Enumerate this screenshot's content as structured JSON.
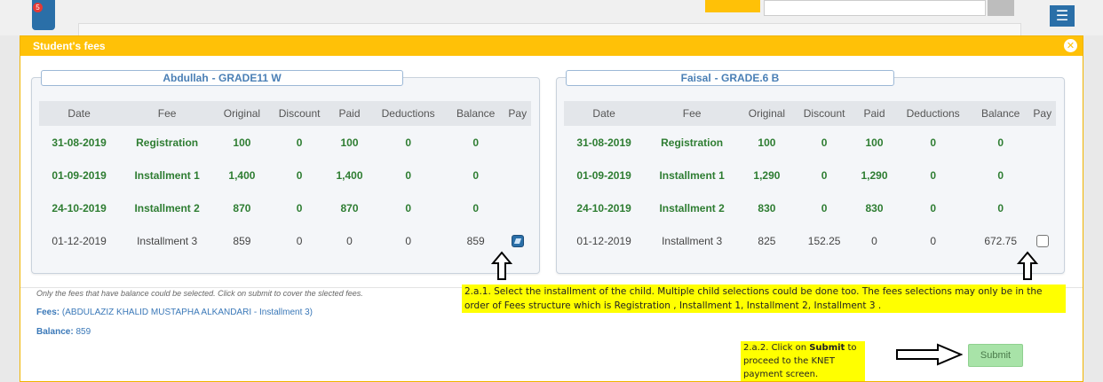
{
  "background": {
    "badge": "5",
    "menu_icon": "menu-icon"
  },
  "modal": {
    "title": "Student's fees",
    "close_icon": "close-icon"
  },
  "columns": [
    "Date",
    "Fee",
    "Original",
    "Discount",
    "Paid",
    "Deductions",
    "Balance",
    "Pay"
  ],
  "children": [
    {
      "name": "Abdullah",
      "grade": "- GRADE11 W",
      "rows": [
        {
          "date": "31-08-2019",
          "fee": "Registration",
          "original": "100",
          "discount": "0",
          "paid": "100",
          "deductions": "0",
          "balance": "0",
          "status": "paid",
          "selectable": false,
          "checked": false
        },
        {
          "date": "01-09-2019",
          "fee": "Installment 1",
          "original": "1,400",
          "discount": "0",
          "paid": "1,400",
          "deductions": "0",
          "balance": "0",
          "status": "paid",
          "selectable": false,
          "checked": false
        },
        {
          "date": "24-10-2019",
          "fee": "Installment 2",
          "original": "870",
          "discount": "0",
          "paid": "870",
          "deductions": "0",
          "balance": "0",
          "status": "paid",
          "selectable": false,
          "checked": false
        },
        {
          "date": "01-12-2019",
          "fee": "Installment 3",
          "original": "859",
          "discount": "0",
          "paid": "0",
          "deductions": "0",
          "balance": "859",
          "status": "due",
          "selectable": true,
          "checked": true
        }
      ]
    },
    {
      "name": "Faisal",
      "grade": "- GRADE.6 B",
      "rows": [
        {
          "date": "31-08-2019",
          "fee": "Registration",
          "original": "100",
          "discount": "0",
          "paid": "100",
          "deductions": "0",
          "balance": "0",
          "status": "paid",
          "selectable": false,
          "checked": false
        },
        {
          "date": "01-09-2019",
          "fee": "Installment 1",
          "original": "1,290",
          "discount": "0",
          "paid": "1,290",
          "deductions": "0",
          "balance": "0",
          "status": "paid",
          "selectable": false,
          "checked": false
        },
        {
          "date": "24-10-2019",
          "fee": "Installment 2",
          "original": "830",
          "discount": "0",
          "paid": "830",
          "deductions": "0",
          "balance": "0",
          "status": "paid",
          "selectable": false,
          "checked": false
        },
        {
          "date": "01-12-2019",
          "fee": "Installment 3",
          "original": "825",
          "discount": "152.25",
          "paid": "0",
          "deductions": "0",
          "balance": "672.75",
          "status": "due",
          "selectable": true,
          "checked": false
        }
      ]
    }
  ],
  "footer": {
    "note": "Only the fees that have balance could be selected. Click on submit to cover the slected fees.",
    "fees_label": "Fees:",
    "fees_value": "(ABDULAZIZ KHALID MUSTAPHA ALKANDARI - Installment 3)",
    "balance_label": "Balance:",
    "balance_value": "859",
    "submit_label": "Submit"
  },
  "annotations": {
    "note_1": "2.a.1. Select the installment of the child. Multiple child selections could be done too. The fees selections may only be in the order of Fees structure which is Registration , Installment 1, Installment 2, Installment 3 .",
    "note_2_prefix": "2.a.2. Click on",
    "note_2_bold": "Submit",
    "note_2_suffix": "to proceed to the KNET payment screen."
  },
  "colors": {
    "header": "#ffc107",
    "paid_text": "#2e7d32",
    "link": "#3a78b8",
    "submit": "#a8e3a8",
    "highlight": "#ffff00"
  }
}
